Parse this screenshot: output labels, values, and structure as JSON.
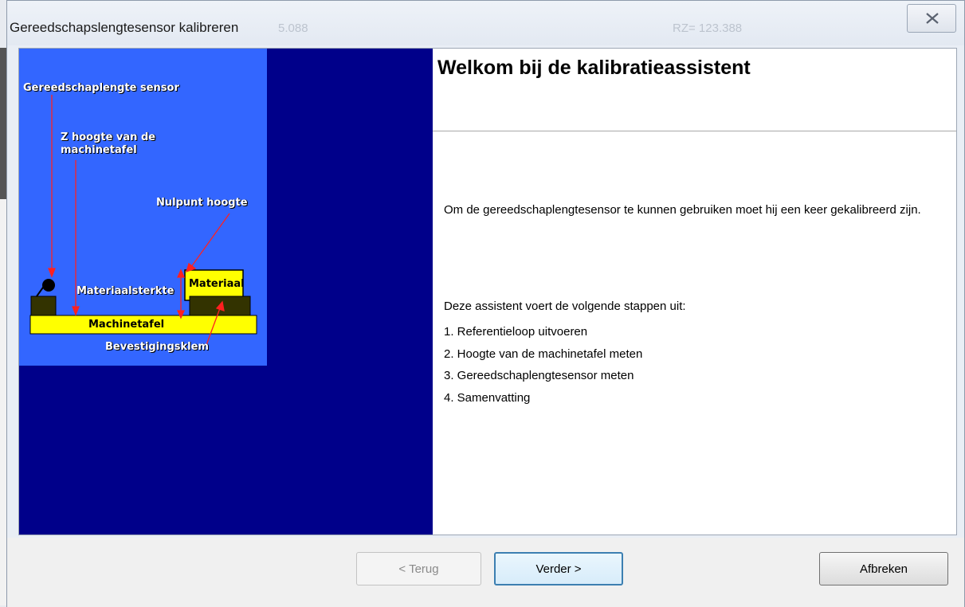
{
  "window": {
    "title": "Gereedschapslengtesensor kalibreren",
    "bg_text_left": "5.088",
    "bg_text_right": "RZ= 123.388"
  },
  "diagram": {
    "label_sensor": "Gereedschaplengte sensor",
    "label_z_line1": "Z hoogte van de",
    "label_z_line2": "machinetafel",
    "label_zero": "Nulpunt hoogte",
    "label_thickness": "Materiaalsterkte",
    "label_material": "Materiaal",
    "label_table": "Machinetafel",
    "label_clamp": "Bevestigingsklem",
    "colors": {
      "sky": "#3366ff",
      "navy": "#00008a",
      "yellow": "#ffff00",
      "arrow": "#ff2020"
    }
  },
  "content": {
    "heading": "Welkom bij de kalibratieassistent",
    "paragraph": "Om de gereedschaplengtesensor te kunnen gebruiken moet hij een keer gekalibreerd zijn.",
    "steps_intro": "Deze assistent voert de volgende stappen uit:",
    "steps": [
      "1. Referentieloop uitvoeren",
      "2. Hoogte van de machinetafel meten",
      "3. Gereedschaplengtesensor meten",
      "4. Samenvatting"
    ]
  },
  "buttons": {
    "back": "< Terug",
    "next": "Verder >",
    "cancel": "Afbreken"
  }
}
